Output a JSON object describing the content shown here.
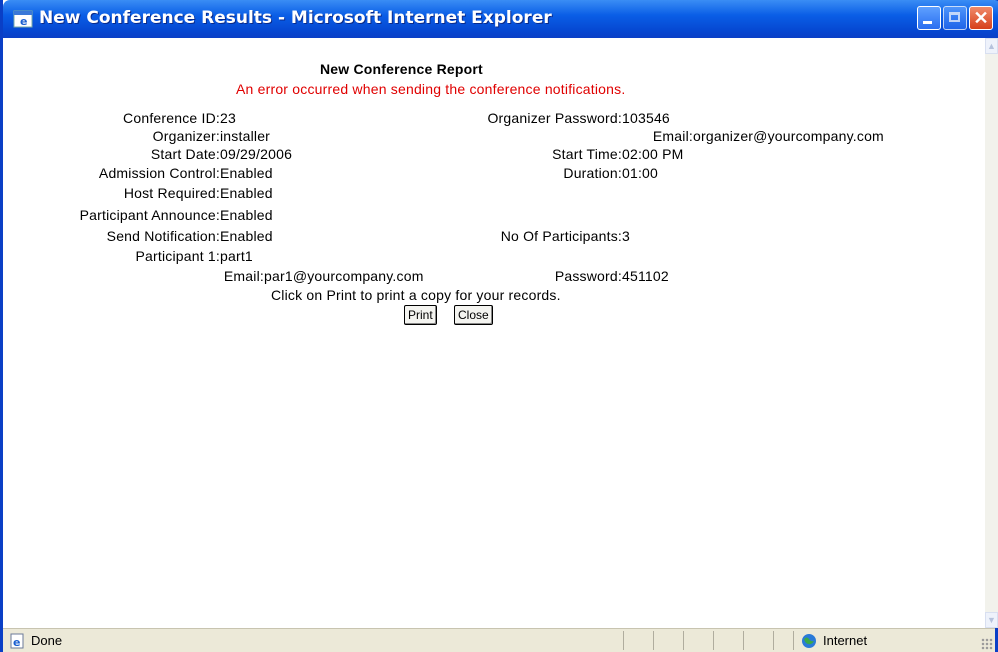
{
  "window": {
    "title": "New Conference Results - Microsoft Internet Explorer",
    "icon": "ie-window-icon",
    "controls": [
      "minimize-icon",
      "maximize-icon",
      "close-icon"
    ]
  },
  "report": {
    "heading": "New Conference Report",
    "error": "An error occurred when sending the conference notifications.",
    "conference_id_label": "Conference ID:",
    "conference_id_value": "23",
    "organizer_password_label": "Organizer Password:",
    "organizer_password_value": "103546",
    "organizer_label": "Organizer:",
    "organizer_value": "installer",
    "organizer_email_label": "Email:",
    "organizer_email_value": "organizer@yourcompany.com",
    "start_date_label": "Start Date:",
    "start_date_value": "09/29/2006",
    "start_time_label": "Start Time:",
    "start_time_value": "02:00 PM",
    "admission_control_label": "Admission Control:",
    "admission_control_value": "Enabled",
    "duration_label": "Duration:",
    "duration_value": "01:00",
    "host_required_label": "Host Required:",
    "host_required_value": "Enabled",
    "participant_announce_label": "Participant Announce:",
    "participant_announce_value": "Enabled",
    "send_notification_label": "Send Notification:",
    "send_notification_value": "Enabled",
    "num_participants_label": "No Of Participants:",
    "num_participants_value": "3",
    "participant1_label": "Participant 1:",
    "participant1_value": "part1",
    "participant1_email_label": "Email:",
    "participant1_email_value": "par1@yourcompany.com",
    "participant1_password_label": "Password:",
    "participant1_password_value": "451102",
    "print_hint": "Click on Print to print a copy for your records.",
    "print_button": "Print",
    "close_button": "Close"
  },
  "statusbar": {
    "status": "Done",
    "zone": "Internet",
    "status_icon": "ie-page-icon",
    "zone_icon": "globe-icon"
  }
}
